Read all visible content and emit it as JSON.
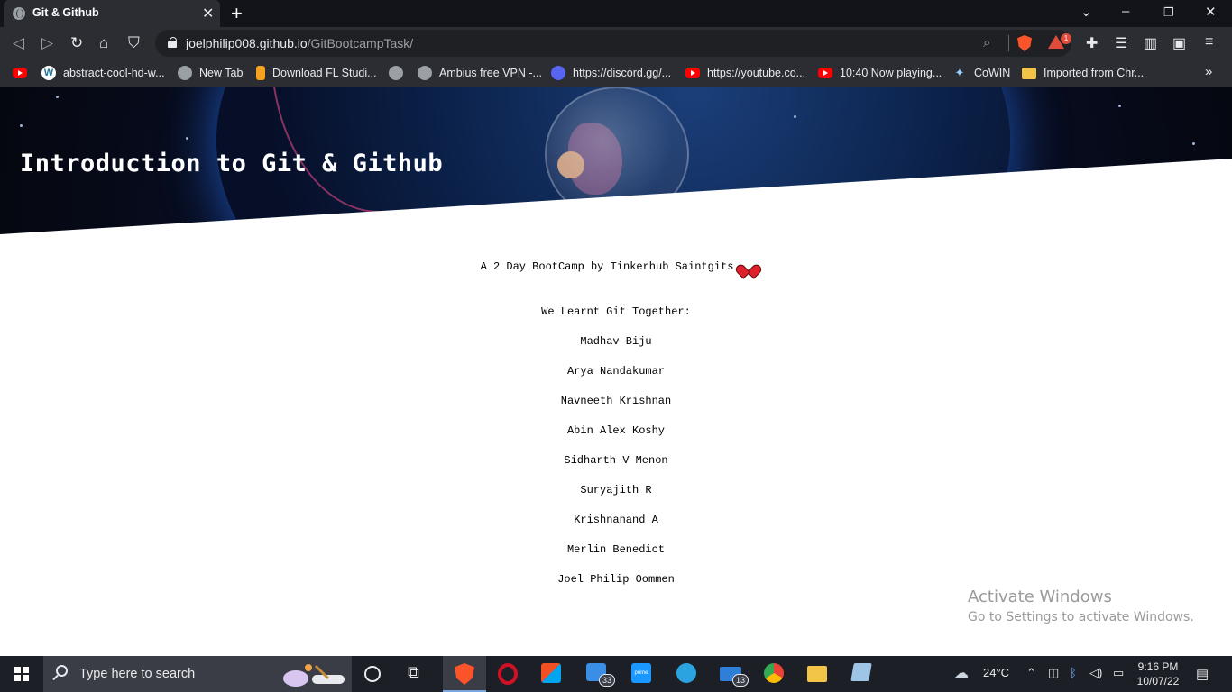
{
  "browser": {
    "tab_title": "Git & Github",
    "url_host": "joelphilip008.github.io",
    "url_path": "/GitBootcampTask/",
    "rewards_count": "1"
  },
  "bookmarks": [
    {
      "label": "",
      "icon": "youtube-icon"
    },
    {
      "label": "abstract-cool-hd-w...",
      "icon": "wordpress-icon"
    },
    {
      "label": "New Tab",
      "icon": "globe-icon"
    },
    {
      "label": "Download FL Studi...",
      "icon": "fl-studio-icon"
    },
    {
      "label": "",
      "icon": "globe-icon"
    },
    {
      "label": "Ambius free VPN -...",
      "icon": "globe-icon"
    },
    {
      "label": "https://discord.gg/...",
      "icon": "discord-icon"
    },
    {
      "label": "https://youtube.co...",
      "icon": "youtube-icon"
    },
    {
      "label": "10:40 Now playing...",
      "icon": "youtube-icon"
    },
    {
      "label": "CoWIN",
      "icon": "cowin-icon"
    },
    {
      "label": "Imported from Chr...",
      "icon": "folder-icon"
    }
  ],
  "page": {
    "title": "Introduction to Git & Github",
    "subtitle": "A 2 Day BootCamp by Tinkerhub Saintgits",
    "learnt_heading": "We Learnt Git Together:",
    "members": [
      "Madhav Biju",
      "Arya Nandakumar",
      "Navneeth Krishnan",
      "Abin Alex Koshy",
      "Sidharth V Menon",
      "Suryajith R",
      "Krishnanand A",
      "Merlin Benedict",
      "Joel Philip Oommen"
    ]
  },
  "watermark": {
    "title": "Activate Windows",
    "subtitle": "Go to Settings to activate Windows."
  },
  "taskbar": {
    "search_placeholder": "Type here to search",
    "store_badge": "33",
    "mail_badge": "13",
    "temperature": "24°C",
    "time": "9:16 PM",
    "date": "10/07/22"
  },
  "colors": {
    "heart": "#e0202a",
    "brave": "#fb542b",
    "titlebar": "#131419",
    "toolbar": "#2b2d33"
  }
}
